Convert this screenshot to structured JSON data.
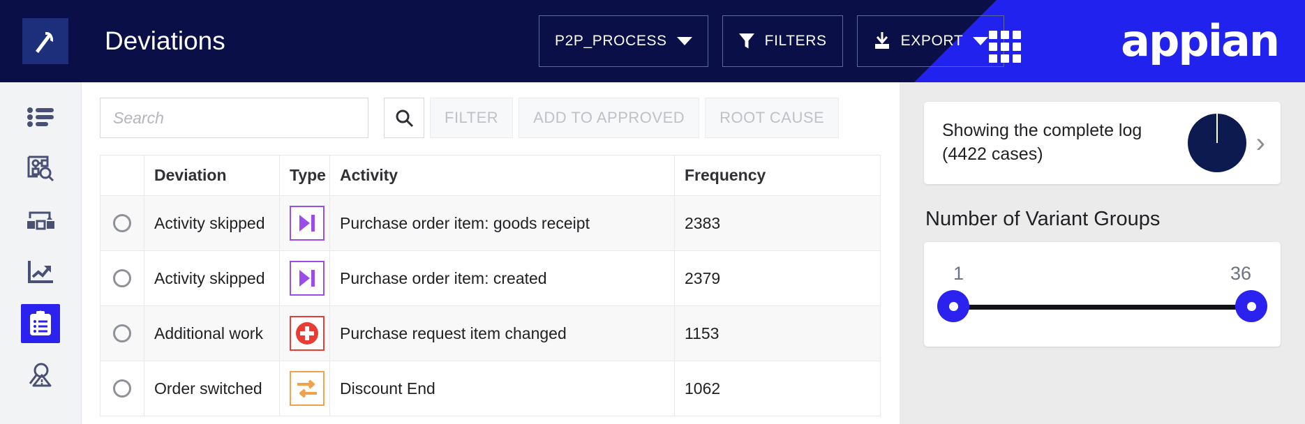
{
  "header": {
    "title": "Deviations",
    "app_icon": "pickaxe-icon",
    "brand": "appian",
    "process_selector": "P2P_PROCESS",
    "filters_label": "FILTERS",
    "export_label": "EXPORT",
    "grid_icon": "apps-grid-icon",
    "colors": {
      "bar": "#0a1047",
      "wedge": "#2222ee",
      "icon_tile": "#1d2f7a"
    }
  },
  "sidebar": {
    "items": [
      {
        "name": "sidebar-item-list",
        "icon": "list-icon",
        "active": false
      },
      {
        "name": "sidebar-item-process-discovery",
        "icon": "process-search-icon",
        "active": false
      },
      {
        "name": "sidebar-item-process-map",
        "icon": "process-map-icon",
        "active": false
      },
      {
        "name": "sidebar-item-analytics",
        "icon": "trending-up-chart-icon",
        "active": false
      },
      {
        "name": "sidebar-item-deviations",
        "icon": "clipboard-list-icon",
        "active": true
      },
      {
        "name": "sidebar-item-root-cause",
        "icon": "magnifier-warning-icon",
        "active": false
      }
    ],
    "active_color": "#2c22f0"
  },
  "toolbar": {
    "search_placeholder": "Search",
    "search_value": "",
    "search_icon": "search-icon",
    "buttons": [
      {
        "label": "FILTER",
        "disabled": true
      },
      {
        "label": "ADD TO APPROVED",
        "disabled": true
      },
      {
        "label": "ROOT CAUSE",
        "disabled": true
      }
    ]
  },
  "table": {
    "columns": [
      "",
      "Deviation",
      "Type",
      "Activity",
      "Frequency"
    ],
    "rows": [
      {
        "selected": false,
        "deviation": "Activity skipped",
        "type_icon": "skip-forward-icon",
        "type_kind": "skip",
        "type_color": "#9b4dea",
        "activity": "Purchase order item: goods receipt",
        "frequency": "2383"
      },
      {
        "selected": false,
        "deviation": "Activity skipped",
        "type_icon": "skip-forward-icon",
        "type_kind": "skip",
        "type_color": "#9b4dea",
        "activity": "Purchase order item: created",
        "frequency": "2379"
      },
      {
        "selected": false,
        "deviation": "Additional work",
        "type_icon": "plus-circle-icon",
        "type_kind": "add",
        "type_color": "#e83c35",
        "activity": "Purchase request item changed",
        "frequency": "1153"
      },
      {
        "selected": false,
        "deviation": "Order switched",
        "type_icon": "swap-arrows-icon",
        "type_kind": "swap",
        "type_color": "#f2a14b",
        "activity": "Discount End",
        "frequency": "1062"
      }
    ]
  },
  "right_panel": {
    "log_card": {
      "text": "Showing the complete log (4422 cases)",
      "chevron_icon": "chevron-right-icon",
      "pie_icon": "full-pie-chart-icon"
    },
    "variant_title": "Number of Variant Groups",
    "slider": {
      "min_label": "1",
      "max_label": "36",
      "handle_color": "#2c22f0"
    }
  },
  "chart_data": {
    "type": "pie",
    "title": "Showing the complete log (4422 cases)",
    "categories": [
      "Complete log"
    ],
    "values": [
      4422
    ],
    "slice_percentages": [
      100
    ],
    "colors": [
      "#0d1a4f"
    ],
    "total_cases": 4422,
    "legend": "none"
  }
}
